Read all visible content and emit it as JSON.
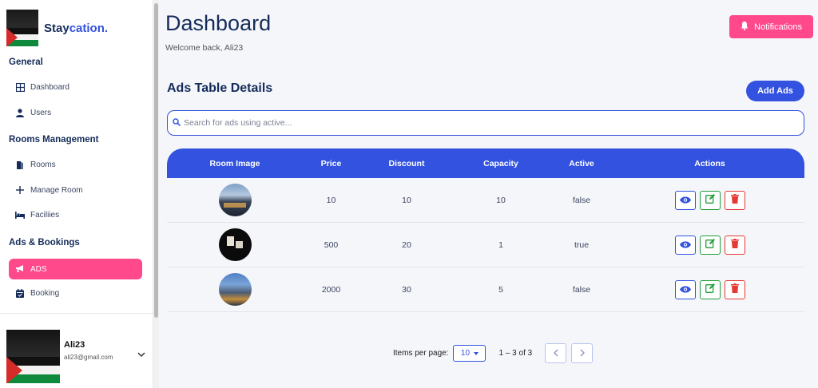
{
  "brand": {
    "part1": "Stay",
    "part2": "cation."
  },
  "sidebar": {
    "sections": [
      {
        "title": "General",
        "items": [
          {
            "label": "Dashboard",
            "icon": "dashboard-icon"
          },
          {
            "label": "Users",
            "icon": "user-icon"
          }
        ]
      },
      {
        "title": "Rooms Management",
        "items": [
          {
            "label": "Rooms",
            "icon": "door-icon"
          },
          {
            "label": "Manage Room",
            "icon": "plus-icon"
          },
          {
            "label": "Faciliies",
            "icon": "bed-icon"
          }
        ]
      },
      {
        "title": "Ads & Bookings",
        "items": [
          {
            "label": "ADS",
            "icon": "megaphone-icon",
            "active": true
          },
          {
            "label": "Booking",
            "icon": "calendar-icon"
          }
        ]
      }
    ],
    "user": {
      "name": "Ali23",
      "email": "ali23@gmail.com"
    }
  },
  "header": {
    "title": "Dashboard",
    "welcome": "Welcome back, Ali23",
    "notifications_label": "Notifications"
  },
  "ads": {
    "title": "Ads Table Details",
    "add_label": "Add Ads",
    "search_placeholder": "Search for ads using active...",
    "columns": [
      "Room Image",
      "Price",
      "Discount",
      "Capacity",
      "Active",
      "Actions"
    ],
    "rows": [
      {
        "price": "10",
        "discount": "10",
        "capacity": "10",
        "active": "false"
      },
      {
        "price": "500",
        "discount": "20",
        "capacity": "1",
        "active": "true"
      },
      {
        "price": "2000",
        "discount": "30",
        "capacity": "5",
        "active": "false"
      }
    ]
  },
  "pagination": {
    "items_per_page_label": "Items per page:",
    "items_per_page": "10",
    "range": "1 – 3 of 3"
  },
  "colors": {
    "primary": "#3252df",
    "accent": "#ff498b",
    "navy": "#152c5b",
    "success": "#1f9d3a",
    "danger": "#e53935"
  }
}
